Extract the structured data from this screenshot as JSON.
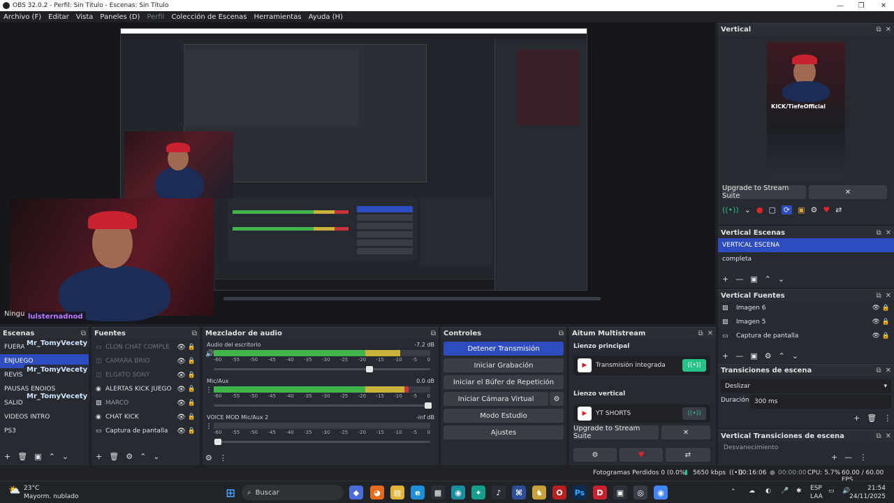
{
  "window": {
    "title": "OBS 32.0.2 - Perfil: Sin Título - Escenas: Sin Título"
  },
  "menu": [
    {
      "label": "Archivo (F)",
      "disabled": false
    },
    {
      "label": "Editar",
      "disabled": false
    },
    {
      "label": "Vista",
      "disabled": false
    },
    {
      "label": "Paneles (D)",
      "disabled": false
    },
    {
      "label": "Perfil",
      "disabled": true
    },
    {
      "label": "Colección de Escenas",
      "disabled": false
    },
    {
      "label": "Herramientas",
      "disabled": false
    },
    {
      "label": "Ayuda (H)",
      "disabled": false
    }
  ],
  "preview": {
    "chat_user_purple": "lulsternadnod",
    "chat_user_1": "Mr_TomyVecety",
    "chat_user_2": "Mr_TomyVecety",
    "chat_user_3": "Mr_TomyVecety",
    "transition_label": "Ningu"
  },
  "scenes": {
    "title": "Escenas",
    "items": [
      "FUERA",
      "ENJUEGO",
      "REVIS",
      "PAUSAS ENOIOS",
      "SALID",
      "VIDEOS INTRO",
      "PS3"
    ],
    "selected": 1
  },
  "sources": {
    "title": "Fuentes",
    "items": [
      {
        "label": "CLON CHAT COMPLE",
        "icon": "browser-icon",
        "dim": true
      },
      {
        "label": "CAMARA BRIO",
        "icon": "camera-icon",
        "dim": true
      },
      {
        "label": "ELGATO SONY",
        "icon": "camera-icon",
        "dim": true
      },
      {
        "label": "ALERTAS KICK JUEGO",
        "icon": "globe-icon",
        "dim": false
      },
      {
        "label": "MARCO",
        "icon": "image-icon",
        "dim": false
      },
      {
        "label": "CHAT KICK",
        "icon": "globe-icon",
        "dim": false
      },
      {
        "label": "Captura de pantalla",
        "icon": "monitor-icon",
        "dim": false
      }
    ]
  },
  "mixer": {
    "title": "Mezclador de audio",
    "scale": [
      "-60",
      "-55",
      "-50",
      "-45",
      "-40",
      "-35",
      "-30",
      "-25",
      "-20",
      "-15",
      "-10",
      "-5",
      "0"
    ],
    "channels": [
      {
        "name": "Audio del escritorio",
        "db": "-7.2 dB",
        "level": 0.86,
        "volume": 0.72
      },
      {
        "name": "Mic/Aux",
        "db": "0.0 dB",
        "level": 0.9,
        "volume": 0.99
      },
      {
        "name": "VOICE MOD Mic/Aux 2",
        "db": "-inf dB",
        "level": 0.0,
        "volume": 0.02
      }
    ]
  },
  "controls": {
    "title": "Controles",
    "stop_stream": "Detener Transmisión",
    "start_record": "Iniciar Grabación",
    "replay_buffer": "Iniciar el Búfer de Repetición",
    "virtual_cam": "Iniciar Cámara Virtual",
    "studio_mode": "Modo Estudio",
    "settings": "Ajustes"
  },
  "multistream": {
    "title": "Aitum Multistream",
    "main_canvas": "Lienzo principal",
    "main_output": "Transmisión integrada",
    "vertical_canvas": "Lienzo vertical",
    "vertical_output": "YT SHORTS",
    "upgrade": "Upgrade to Stream Suite"
  },
  "vertical": {
    "title": "Vertical",
    "upgrade": "Upgrade to Stream Suite",
    "preview_label": "KICK/TiefeOfficial"
  },
  "vertical_scenes": {
    "title": "Vertical Escenas",
    "items": [
      "VERTICAL ESCENA",
      "completa"
    ],
    "selected": 0
  },
  "vertical_sources": {
    "title": "Vertical Fuentes",
    "items": [
      "Imagen 6",
      "Imagen 5",
      "Captura de pantalla"
    ]
  },
  "transitions": {
    "title": "Transiciones de escena",
    "selected": "Deslizar",
    "duration_label": "Duración",
    "duration_value": "300 ms"
  },
  "vertical_transitions": {
    "title": "Vertical Transiciones de escena",
    "selected": "Desvanecimiento"
  },
  "status": {
    "dropped_frames": "Fotogramas Perdidos 0 (0.0%)",
    "bitrate": "5650 kbps",
    "stream_time": "00:16:06",
    "record_time": "00:00:00",
    "cpu": "CPU: 5.7%",
    "fps": "60.00 / 60.00 FPS"
  },
  "taskbar": {
    "weather_temp": "23°C",
    "weather_desc": "Mayorm. nublado",
    "search_placeholder": "Buscar",
    "lang_top": "ESP",
    "lang_bottom": "LAA",
    "time": "21:54",
    "date": "24/11/2025"
  },
  "colors": {
    "accent": "#2d4cbf",
    "meter_green": "#3fb44a",
    "meter_yellow": "#c9b33a",
    "meter_red": "#c8363b",
    "toggle_green": "#27c48a"
  }
}
